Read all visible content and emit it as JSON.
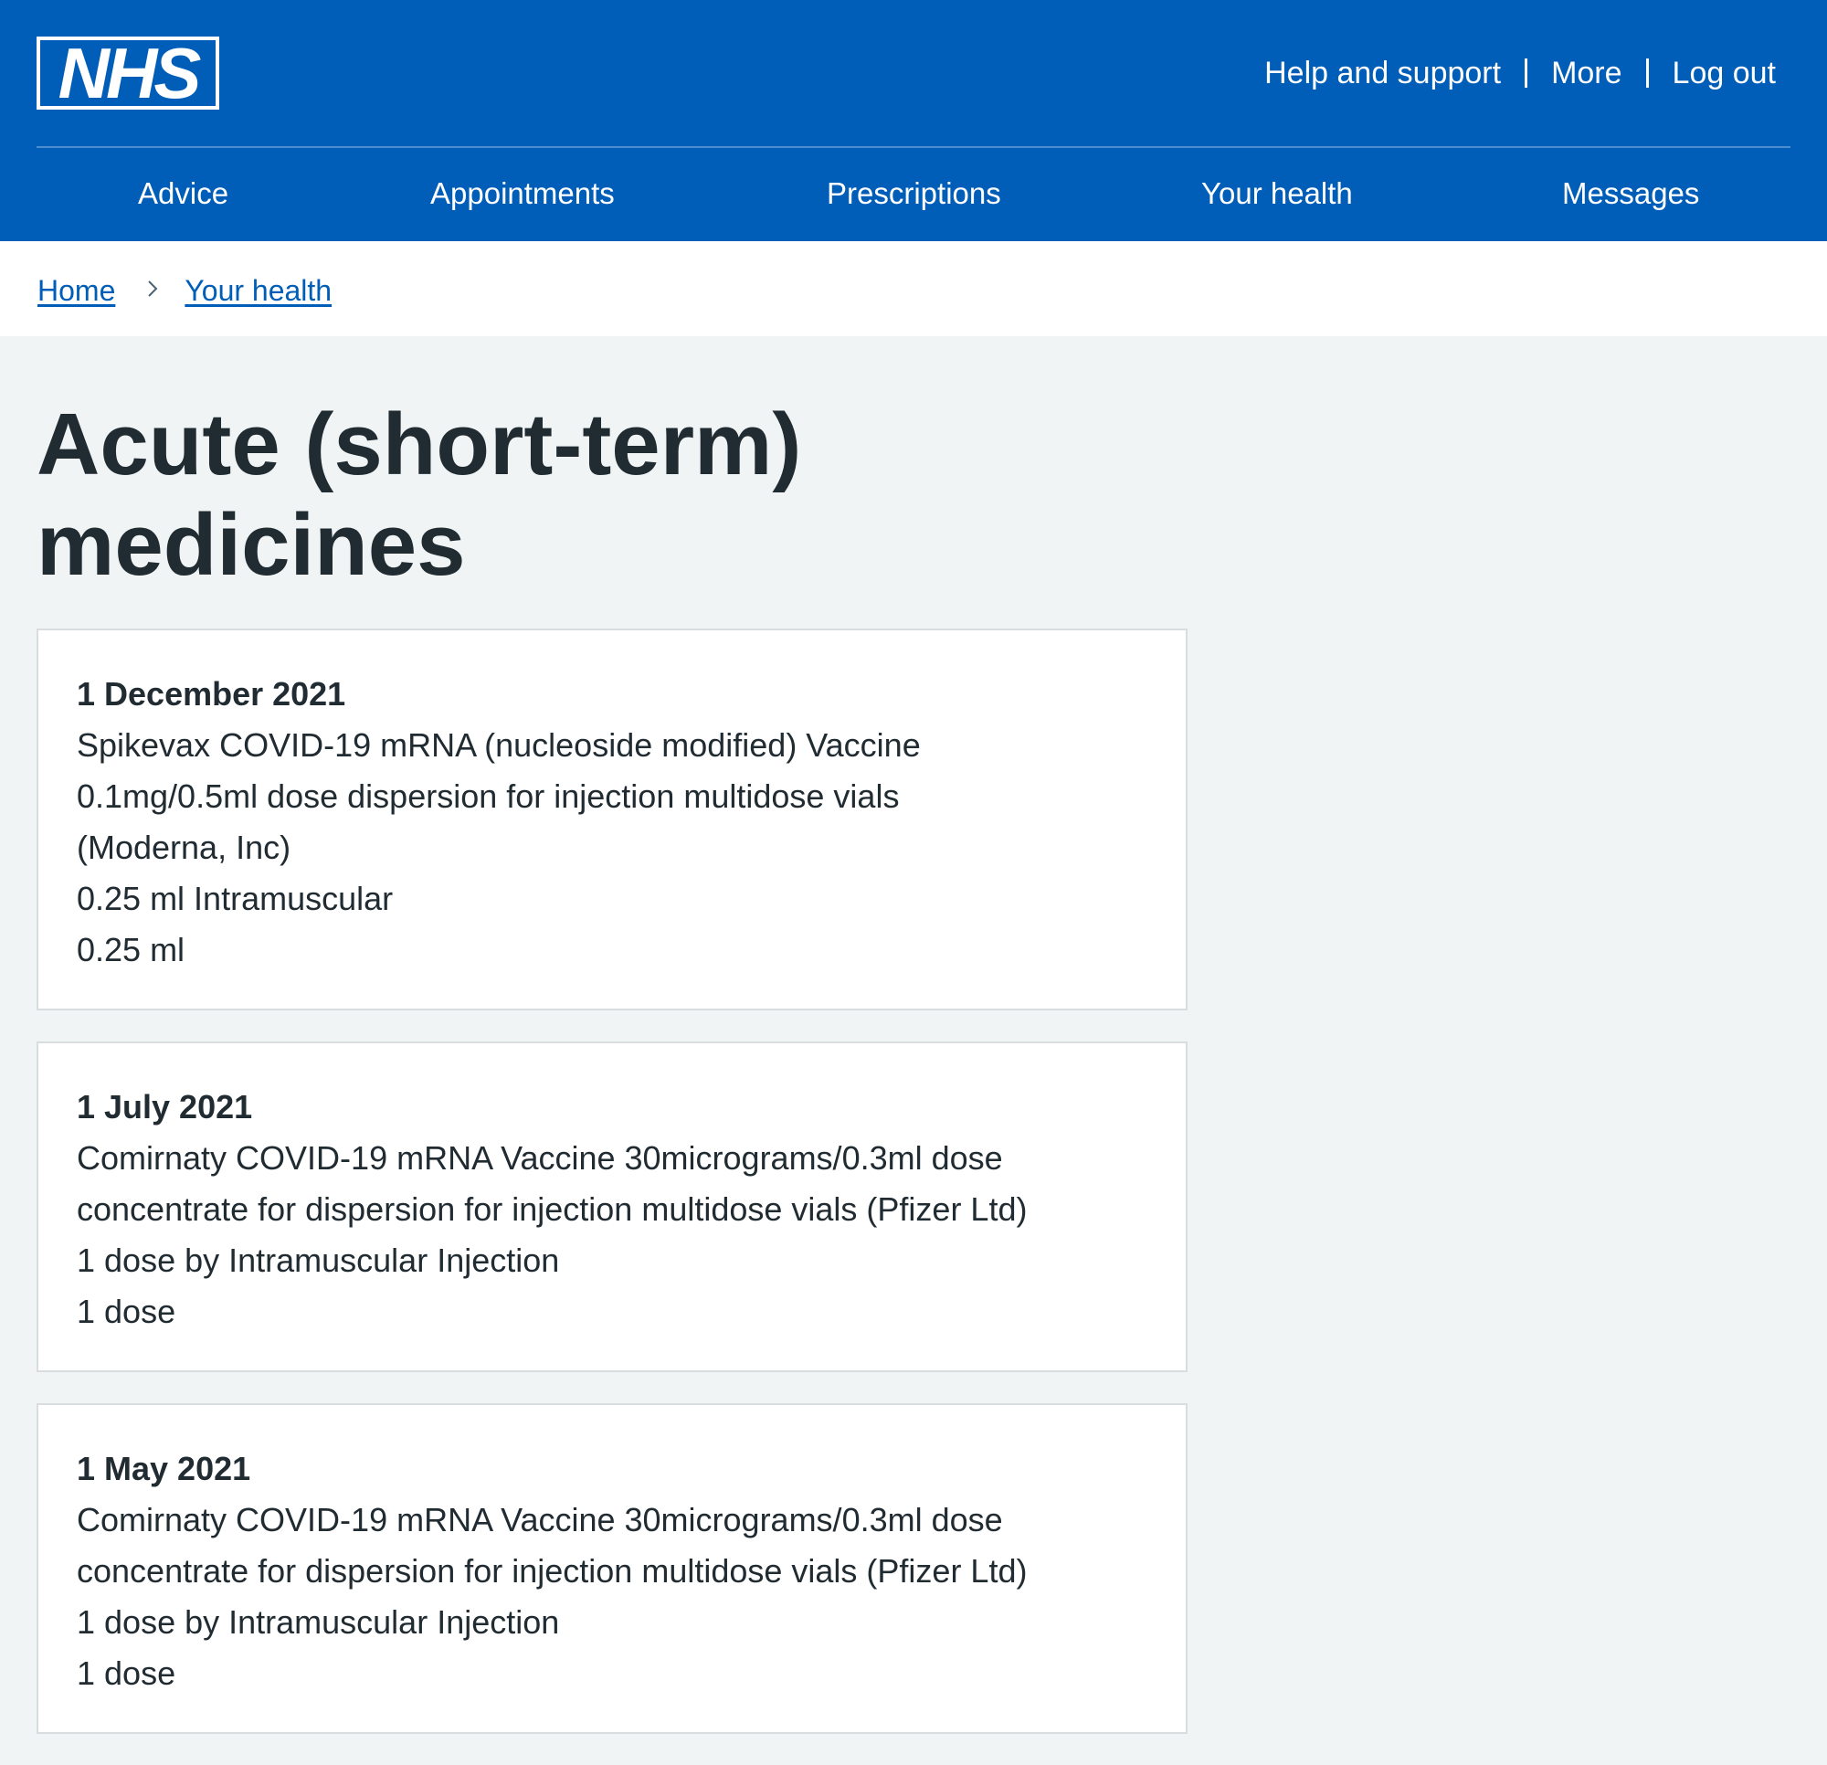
{
  "header": {
    "logo_text": "NHS",
    "utility_links": [
      "Help and support",
      "More",
      "Log out"
    ],
    "nav_items": [
      "Advice",
      "Appointments",
      "Prescriptions",
      "Your health",
      "Messages"
    ]
  },
  "breadcrumb": {
    "items": [
      "Home",
      "Your health"
    ]
  },
  "page": {
    "title": "Acute (short-term) medicines"
  },
  "medicines": [
    {
      "date": "1 December 2021",
      "name": "Spikevax COVID-19 mRNA (nucleoside modified) Vaccine 0.1mg/0.5ml dose dispersion for injection multidose vials (Moderna, Inc)",
      "dosage": "0.25 ml Intramuscular",
      "quantity": "0.25 ml"
    },
    {
      "date": "1 July 2021",
      "name": "Comirnaty COVID-19 mRNA Vaccine 30micrograms/0.3ml dose concentrate for dispersion for injection multidose vials (Pfizer Ltd)",
      "dosage": "1 dose by Intramuscular Injection",
      "quantity": "1 dose"
    },
    {
      "date": "1 May 2021",
      "name": "Comirnaty COVID-19 mRNA Vaccine 30micrograms/0.3ml dose concentrate for dispersion for injection multidose vials (Pfizer Ltd)",
      "dosage": "1 dose by Intramuscular Injection",
      "quantity": "1 dose"
    }
  ],
  "colors": {
    "nhs_blue": "#005eb8",
    "page_background": "#f0f4f5",
    "text": "#212b32",
    "card_border": "#d8dde0"
  }
}
